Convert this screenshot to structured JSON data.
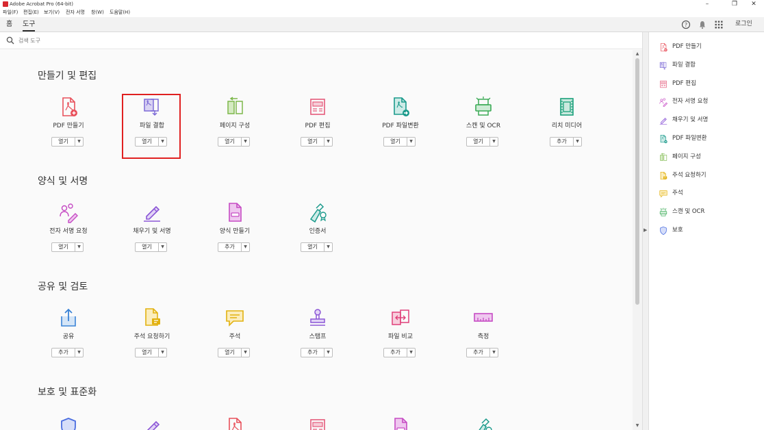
{
  "window": {
    "title": "Adobe Acrobat Pro (64-bit)"
  },
  "menu": [
    "파일(F)",
    "편집(E)",
    "보기(V)",
    "전자 서명",
    "창(W)",
    "도움말(H)"
  ],
  "tabs": {
    "home": "홈",
    "tools": "도구"
  },
  "header": {
    "login": "로그인"
  },
  "search": {
    "placeholder": "검색 도구"
  },
  "sections": [
    {
      "title": "만들기 및 편집",
      "tools": [
        {
          "label": "PDF 만들기",
          "button": "열기",
          "icon": "pdf-create-icon"
        },
        {
          "label": "파일 결합",
          "button": "열기",
          "icon": "combine-files-icon"
        },
        {
          "label": "페이지 구성",
          "button": "열기",
          "icon": "organize-pages-icon"
        },
        {
          "label": "PDF 편집",
          "button": "열기",
          "icon": "edit-pdf-icon"
        },
        {
          "label": "PDF 파일변환",
          "button": "열기",
          "icon": "export-pdf-icon"
        },
        {
          "label": "스캔 및 OCR",
          "button": "열기",
          "icon": "scan-ocr-icon"
        },
        {
          "label": "리치 미디어",
          "button": "추가",
          "icon": "rich-media-icon"
        }
      ]
    },
    {
      "title": "양식 및 서명",
      "tools": [
        {
          "label": "전자 서명 요청",
          "button": "열기",
          "icon": "request-signatures-icon"
        },
        {
          "label": "채우기 및 서명",
          "button": "열기",
          "icon": "fill-sign-icon"
        },
        {
          "label": "양식 만들기",
          "button": "추가",
          "icon": "prepare-form-icon"
        },
        {
          "label": "인증서",
          "button": "열기",
          "icon": "certificates-icon"
        }
      ]
    },
    {
      "title": "공유 및 검토",
      "tools": [
        {
          "label": "공유",
          "button": "추가",
          "icon": "share-icon"
        },
        {
          "label": "주석 요청하기",
          "button": "열기",
          "icon": "send-comments-icon"
        },
        {
          "label": "주석",
          "button": "열기",
          "icon": "comment-icon"
        },
        {
          "label": "스탬프",
          "button": "추가",
          "icon": "stamp-icon"
        },
        {
          "label": "파일 비교",
          "button": "추가",
          "icon": "compare-files-icon"
        },
        {
          "label": "측정",
          "button": "추가",
          "icon": "measure-icon"
        }
      ]
    },
    {
      "title": "보호 및 표준화",
      "tools": []
    }
  ],
  "right_panel": [
    {
      "label": "PDF 만들기",
      "icon": "pdf-create-icon"
    },
    {
      "label": "파일 결합",
      "icon": "combine-files-icon"
    },
    {
      "label": "PDF 편집",
      "icon": "edit-pdf-icon"
    },
    {
      "label": "전자 서명 요청",
      "icon": "request-signatures-icon"
    },
    {
      "label": "채우기 및 서명",
      "icon": "fill-sign-icon"
    },
    {
      "label": "PDF 파일변환",
      "icon": "export-pdf-icon"
    },
    {
      "label": "페이지 구성",
      "icon": "organize-pages-icon"
    },
    {
      "label": "주석 요청하기",
      "icon": "send-comments-icon"
    },
    {
      "label": "주석",
      "icon": "comment-icon"
    },
    {
      "label": "스캔 및 OCR",
      "icon": "scan-ocr-icon"
    },
    {
      "label": "보호",
      "icon": "protect-icon"
    }
  ],
  "colors": {
    "accent_red": "#e02020",
    "brand": "#d7282f"
  }
}
